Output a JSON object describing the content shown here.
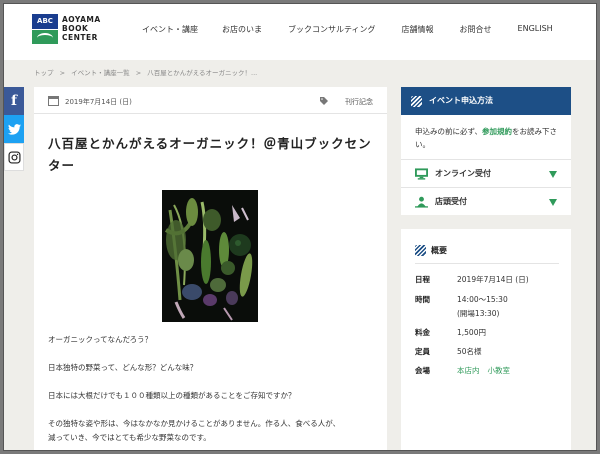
{
  "logo": {
    "badge": "ABC",
    "lines": [
      "AOYAMA",
      "BOOK",
      "CENTER"
    ]
  },
  "nav": [
    "イベント・講座",
    "お店のいま",
    "ブックコンサルティング",
    "店舗情報",
    "お問合せ",
    "ENGLISH"
  ],
  "breadcrumb": [
    "トップ",
    ">",
    "イベント・講座一覧",
    ">",
    "八百屋とかんがえるオーガニック！..."
  ],
  "social": {
    "facebook": "f"
  },
  "article": {
    "date": "2019年7月14日 (日)",
    "tag": "刊行記念",
    "title": "八百屋とかんがえるオーガニック！＠青山ブックセンター",
    "paragraphs": [
      "オーガニックってなんだろう？",
      "日本独特の野菜って、どんな形？どんな味？",
      "日本には大根だけでも１００種類以上の種類があることをご存知ですか？",
      "その独特な姿や形は、今はなかなか見かけることがありません。作る人、食べる人が、",
      "減っていき、今ではとても希少な野菜なのです。"
    ]
  },
  "sidebar": {
    "apply": {
      "heading": "イベント申込方法",
      "note_before": "申込みの前に必ず、",
      "note_link": "参加規約",
      "note_after": "をお読み下さい。",
      "rows": [
        "オンライン受付",
        "店頭受付"
      ]
    },
    "overview": {
      "heading": "概要",
      "items": [
        {
          "label": "日程",
          "value": "2019年7月14日 (日)"
        },
        {
          "label": "時間",
          "value": "14:00～15:30"
        },
        {
          "label": "",
          "value": "(開場13:30)"
        },
        {
          "label": "料金",
          "value": "1,500円"
        },
        {
          "label": "定員",
          "value": "50名様"
        },
        {
          "label": "会場",
          "value": ""
        }
      ],
      "venue_links": [
        "本店内",
        "小教室"
      ]
    }
  },
  "colors": {
    "brand_blue": "#1d4f86",
    "accent_green": "#2f9a5a"
  }
}
